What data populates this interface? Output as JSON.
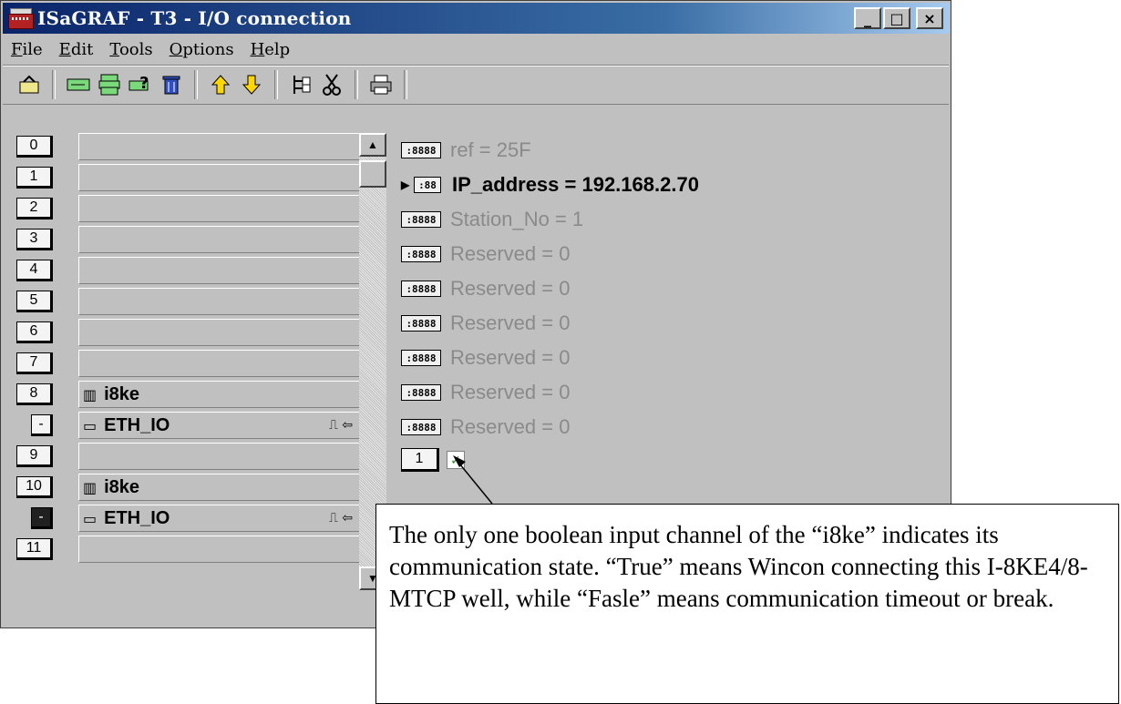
{
  "window": {
    "title": "ISaGRAF - T3 - I/O connection",
    "buttons": [
      "_",
      "□",
      "×"
    ]
  },
  "menu": [
    {
      "first": "F",
      "rest": "ile"
    },
    {
      "first": "E",
      "rest": "dit"
    },
    {
      "first": "T",
      "rest": "ools"
    },
    {
      "first": "O",
      "rest": "ptions"
    },
    {
      "first": "H",
      "rest": "elp"
    }
  ],
  "toolbar": {
    "icons": [
      "open-icon",
      "board-icon",
      "board-list-icon",
      "board-help-icon",
      "delete-icon",
      "move-up-icon",
      "move-down-icon",
      "tree-icon",
      "cut-icon",
      "print-icon"
    ]
  },
  "slots": [
    {
      "num": "0",
      "label": ""
    },
    {
      "num": "1",
      "label": ""
    },
    {
      "num": "2",
      "label": ""
    },
    {
      "num": "3",
      "label": ""
    },
    {
      "num": "4",
      "label": ""
    },
    {
      "num": "5",
      "label": ""
    },
    {
      "num": "6",
      "label": ""
    },
    {
      "num": "7",
      "label": ""
    },
    {
      "num": "8",
      "label": "i8ke",
      "icon": "▥"
    },
    {
      "num": "-",
      "label": "ETH_IO",
      "icon": "▭",
      "sub": true,
      "right": "⎍ ⇦"
    },
    {
      "num": "9",
      "label": ""
    },
    {
      "num": "10",
      "label": "i8ke",
      "icon": "▥"
    },
    {
      "num": "-",
      "label": "ETH_IO",
      "icon": "▭",
      "sub": true,
      "dark": true,
      "right": "⎍ ⇦"
    },
    {
      "num": "11",
      "label": ""
    }
  ],
  "params": [
    {
      "icon": ":8888",
      "text": "ref = 25F"
    },
    {
      "icon": ":88",
      "text": "IP_address = 192.168.2.70",
      "active": true
    },
    {
      "icon": ":8888",
      "text": "Station_No = 1"
    },
    {
      "icon": ":8888",
      "text": "Reserved = 0"
    },
    {
      "icon": ":8888",
      "text": "Reserved = 0"
    },
    {
      "icon": ":8888",
      "text": "Reserved = 0"
    },
    {
      "icon": ":8888",
      "text": "Reserved = 0"
    },
    {
      "icon": ":8888",
      "text": "Reserved = 0"
    },
    {
      "icon": ":8888",
      "text": "Reserved = 0"
    }
  ],
  "channel": {
    "num": "1"
  },
  "callout": {
    "text": "The only one boolean input channel of the “i8ke” indicates its communication state. “True” means Wincon connecting this I-8KE4/8-MTCP well, while “Fasle” means communication timeout or break."
  }
}
